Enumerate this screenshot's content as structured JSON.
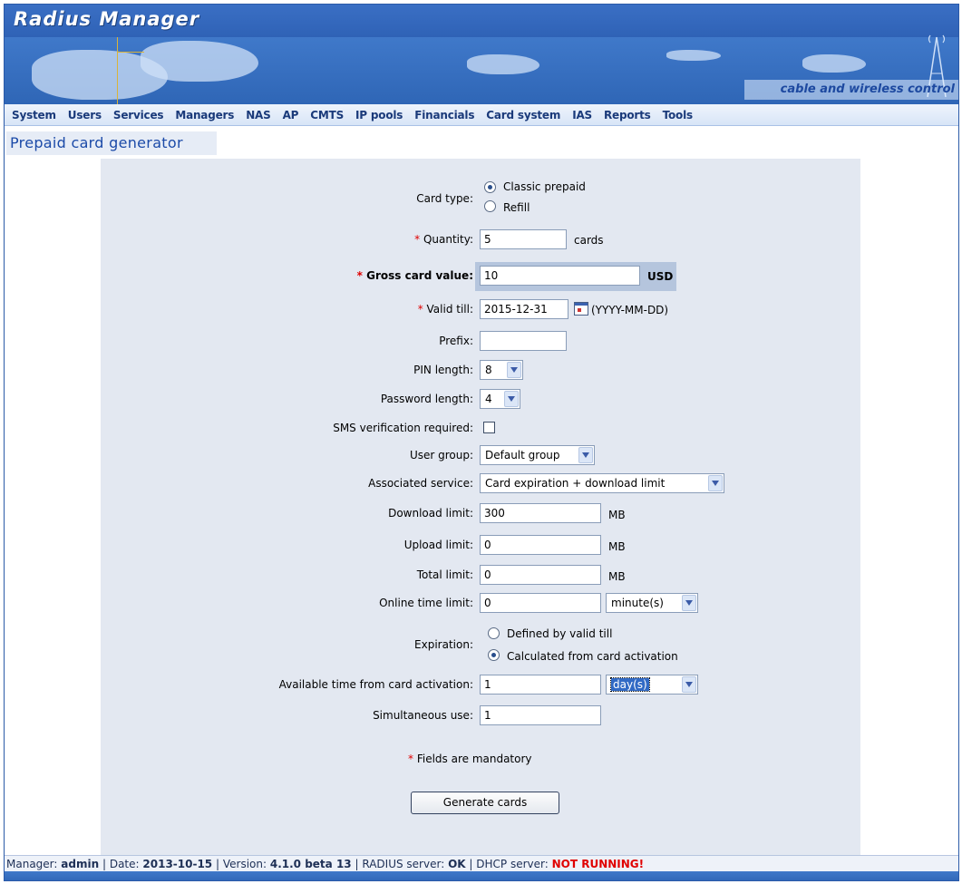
{
  "app": {
    "logo": "Radius Manager",
    "tagline": "cable and wireless control"
  },
  "nav": [
    "System",
    "Users",
    "Services",
    "Managers",
    "NAS",
    "AP",
    "CMTS",
    "IP pools",
    "Financials",
    "Card system",
    "IAS",
    "Reports",
    "Tools"
  ],
  "page_title": "Prepaid card generator",
  "form": {
    "card_type": {
      "label": "Card type:",
      "options": [
        "Classic prepaid",
        "Refill"
      ],
      "selected": "Classic prepaid"
    },
    "quantity": {
      "req": "*",
      "label": "Quantity:",
      "value": "5",
      "unit": "cards"
    },
    "gross_value": {
      "req": "*",
      "label": "Gross card value:",
      "value": "10",
      "unit": "USD"
    },
    "valid_till": {
      "req": "*",
      "label": "Valid till:",
      "value": "2015-12-31",
      "hint": "(YYYY-MM-DD)"
    },
    "prefix": {
      "label": "Prefix:",
      "value": ""
    },
    "pin_length": {
      "label": "PIN length:",
      "value": "8"
    },
    "password_length": {
      "label": "Password length:",
      "value": "4"
    },
    "sms": {
      "label": "SMS verification required:",
      "checked": false
    },
    "user_group": {
      "label": "User group:",
      "value": "Default group"
    },
    "service": {
      "label": "Associated service:",
      "value": "Card expiration + download limit"
    },
    "download": {
      "label": "Download limit:",
      "value": "300",
      "unit": "MB"
    },
    "upload": {
      "label": "Upload limit:",
      "value": "0",
      "unit": "MB"
    },
    "total": {
      "label": "Total limit:",
      "value": "0",
      "unit": "MB"
    },
    "online": {
      "label": "Online time limit:",
      "value": "0",
      "unit": "minute(s)"
    },
    "expiration": {
      "label": "Expiration:",
      "options": [
        "Defined by valid till",
        "Calculated from card activation"
      ],
      "selected": "Calculated from card activation"
    },
    "available": {
      "label": "Available time from card activation:",
      "value": "1",
      "unit": "day(s)"
    },
    "simultaneous": {
      "label": "Simultaneous use:",
      "value": "1"
    },
    "mandatory_note": {
      "req": "*",
      "text": "Fields are mandatory"
    },
    "submit": "Generate cards"
  },
  "status": {
    "manager_label": "Manager:",
    "manager": "admin",
    "sep": "|",
    "date_label": "Date:",
    "date": "2013-10-15",
    "version_label": "Version:",
    "version": "4.1.0 beta 13",
    "radius_label": "RADIUS server:",
    "radius": "OK",
    "dhcp_label": "DHCP server:",
    "dhcp": "NOT RUNNING!"
  },
  "colors": {
    "accent": "#1b4aa8",
    "error": "#e00000",
    "panel": "#e3e8f1",
    "banner": "#3f78c9"
  }
}
